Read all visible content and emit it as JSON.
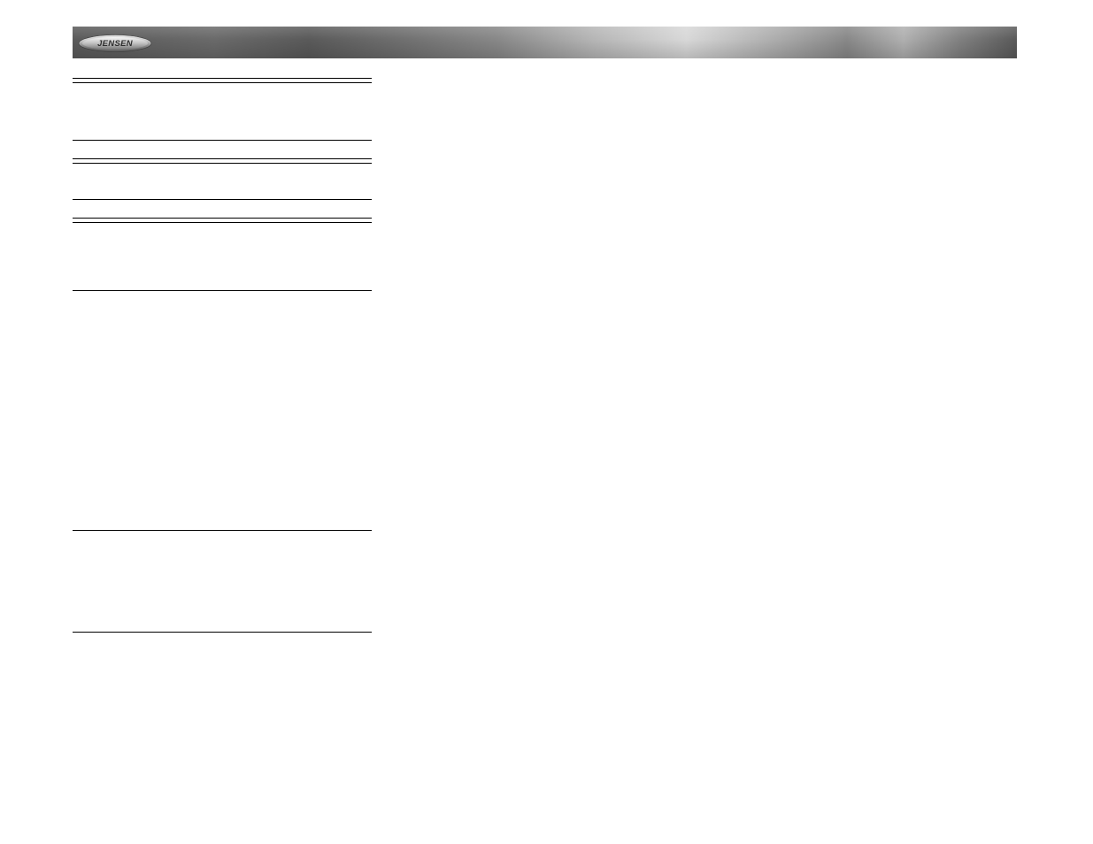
{
  "brand": {
    "name": "JENSEN"
  }
}
